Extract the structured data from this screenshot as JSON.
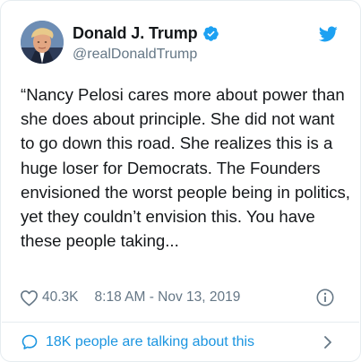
{
  "tweet": {
    "author": {
      "display_name": "Donald J. Trump",
      "handle": "@realDonaldTrump",
      "verified": true
    },
    "text": "“Nancy Pelosi cares more about power than she does about principle. She did not want to go down this road. She realizes this is a huge loser for Democrats. The Founders envisioned the worst people being in politics, yet they couldn’t envision this. You have these people taking...",
    "likes": "40.3K",
    "timestamp": "8:18 AM - Nov 13, 2019",
    "talking_about": "18K people are talking about this"
  },
  "icons": {
    "brand": "twitter-bird-icon",
    "verified": "verified-badge-icon",
    "like": "heart-icon",
    "info": "info-icon",
    "conversation": "speech-bubble-icon",
    "chevron": "chevron-right-icon"
  },
  "colors": {
    "brand_blue": "#1da1f2",
    "link_blue": "#1b95e0",
    "text": "#14171a",
    "secondary_text": "#657786",
    "border": "#e6ecf0"
  }
}
